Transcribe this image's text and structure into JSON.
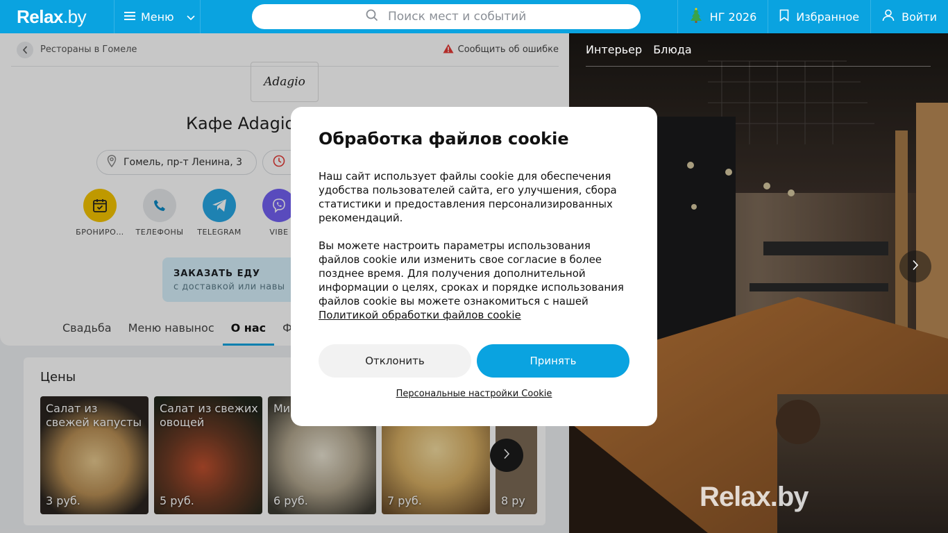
{
  "header": {
    "logo": "Relax",
    "logo_tld": ".by",
    "menu_label": "Меню",
    "search_placeholder": "Поиск мест и событий",
    "ny_label": "НГ 2026",
    "favorites_label": "Избранное",
    "login_label": "Войти"
  },
  "breadcrumb": {
    "back_label": "Рестораны в Гомеле",
    "report_label": "Сообщить об ошибке"
  },
  "place": {
    "logo_text": "Adagio",
    "title": "Кафе Adagio",
    "address": "Гомель, пр-т Ленина, 3",
    "actions": [
      {
        "label": "БРОНИРО…",
        "icon": "calendar-check-icon",
        "color": "#f5c400"
      },
      {
        "label": "ТЕЛЕФОНЫ",
        "icon": "phone-icon",
        "color": "#e6e8eb"
      },
      {
        "label": "TELEGRAM",
        "icon": "telegram-icon",
        "color": "#27a7e5"
      },
      {
        "label": "VIBE",
        "icon": "viber-icon",
        "color": "#7360f2"
      }
    ],
    "order_food": {
      "title": "ЗАКАЗАТЬ ЕДУ",
      "subtitle": "с доставкой или навы"
    },
    "tabs": [
      "Свадьба",
      "Меню навынос",
      "О нас",
      "Фот"
    ],
    "active_tab": "О нас"
  },
  "prices": {
    "title": "Цены",
    "dishes": [
      {
        "name": "Салат из свежей капусты",
        "price": "3 руб.",
        "color": "#9a7e58"
      },
      {
        "name": "Салат из свежих овощей",
        "price": "5 руб.",
        "color": "#5b3a26"
      },
      {
        "name": "Ми",
        "price": "6 руб.",
        "color": "#b8ae9a"
      },
      {
        "name": "",
        "price": "7 руб.",
        "color": "#c9a46a"
      }
    ],
    "partial_price": "8 ру"
  },
  "photo": {
    "tabs": [
      "Интерьер",
      "Блюда"
    ],
    "watermark": "Relax.by"
  },
  "cookie_modal": {
    "title": "Обработка файлов cookie",
    "paragraph1": "Наш сайт использует файлы cookie для обеспечения удобства пользователей сайта, его улучшения, сбора статистики и предоставления персонализированных рекомендаций.",
    "paragraph2": "Вы можете настроить параметры использования файлов cookie или изменить свое согласие в более позднее время. Для получения дополнительной информации о целях, сроках и порядке использования файлов cookie вы можете ознакомиться с нашей",
    "policy_link": "Политикой обработки файлов cookie",
    "decline_label": "Отклонить",
    "accept_label": "Принять",
    "personal_settings": "Персональные настройки Cookie"
  },
  "colors": {
    "brand": "#0aa3e0",
    "accent_yellow": "#f5c400"
  }
}
